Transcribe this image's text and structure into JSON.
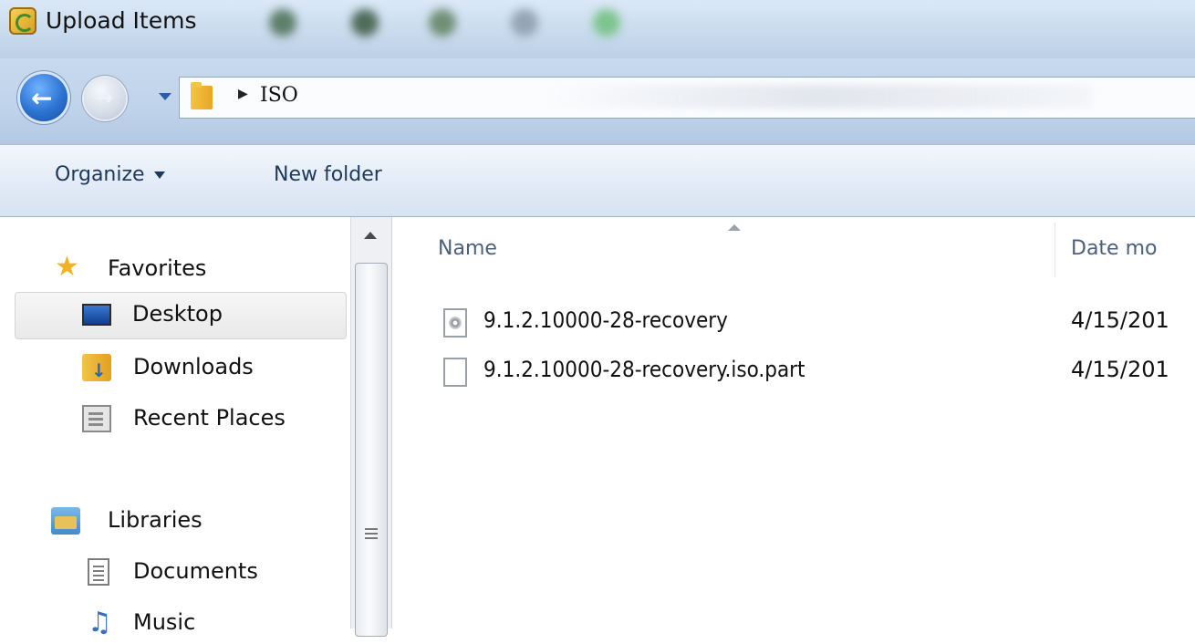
{
  "window": {
    "title": "Upload Items"
  },
  "address": {
    "path": "ISO"
  },
  "commandbar": {
    "organize_label": "Organize",
    "new_folder_label": "New folder"
  },
  "navpane": {
    "items": [
      {
        "label": "Favorites",
        "icon": "star-icon"
      },
      {
        "label": "Desktop",
        "icon": "desktop-icon",
        "selected": true
      },
      {
        "label": "Downloads",
        "icon": "downloads-icon"
      },
      {
        "label": "Recent Places",
        "icon": "recent-places-icon"
      },
      {
        "label": "Libraries",
        "icon": "libraries-icon"
      },
      {
        "label": "Documents",
        "icon": "documents-icon"
      },
      {
        "label": "Music",
        "icon": "music-icon"
      }
    ]
  },
  "filelist": {
    "columns": {
      "name": "Name",
      "date": "Date mo"
    },
    "rows": [
      {
        "name": "9.1.2.10000-28-recovery",
        "date": "4/15/201",
        "icon": "disc-image-icon"
      },
      {
        "name": "9.1.2.10000-28-recovery.iso.part",
        "date": "4/15/201",
        "icon": "file-icon"
      }
    ]
  },
  "colors": {
    "accent": "#2c73d2",
    "titlebar": "#c9dbee",
    "header_text": "#4c607a"
  }
}
